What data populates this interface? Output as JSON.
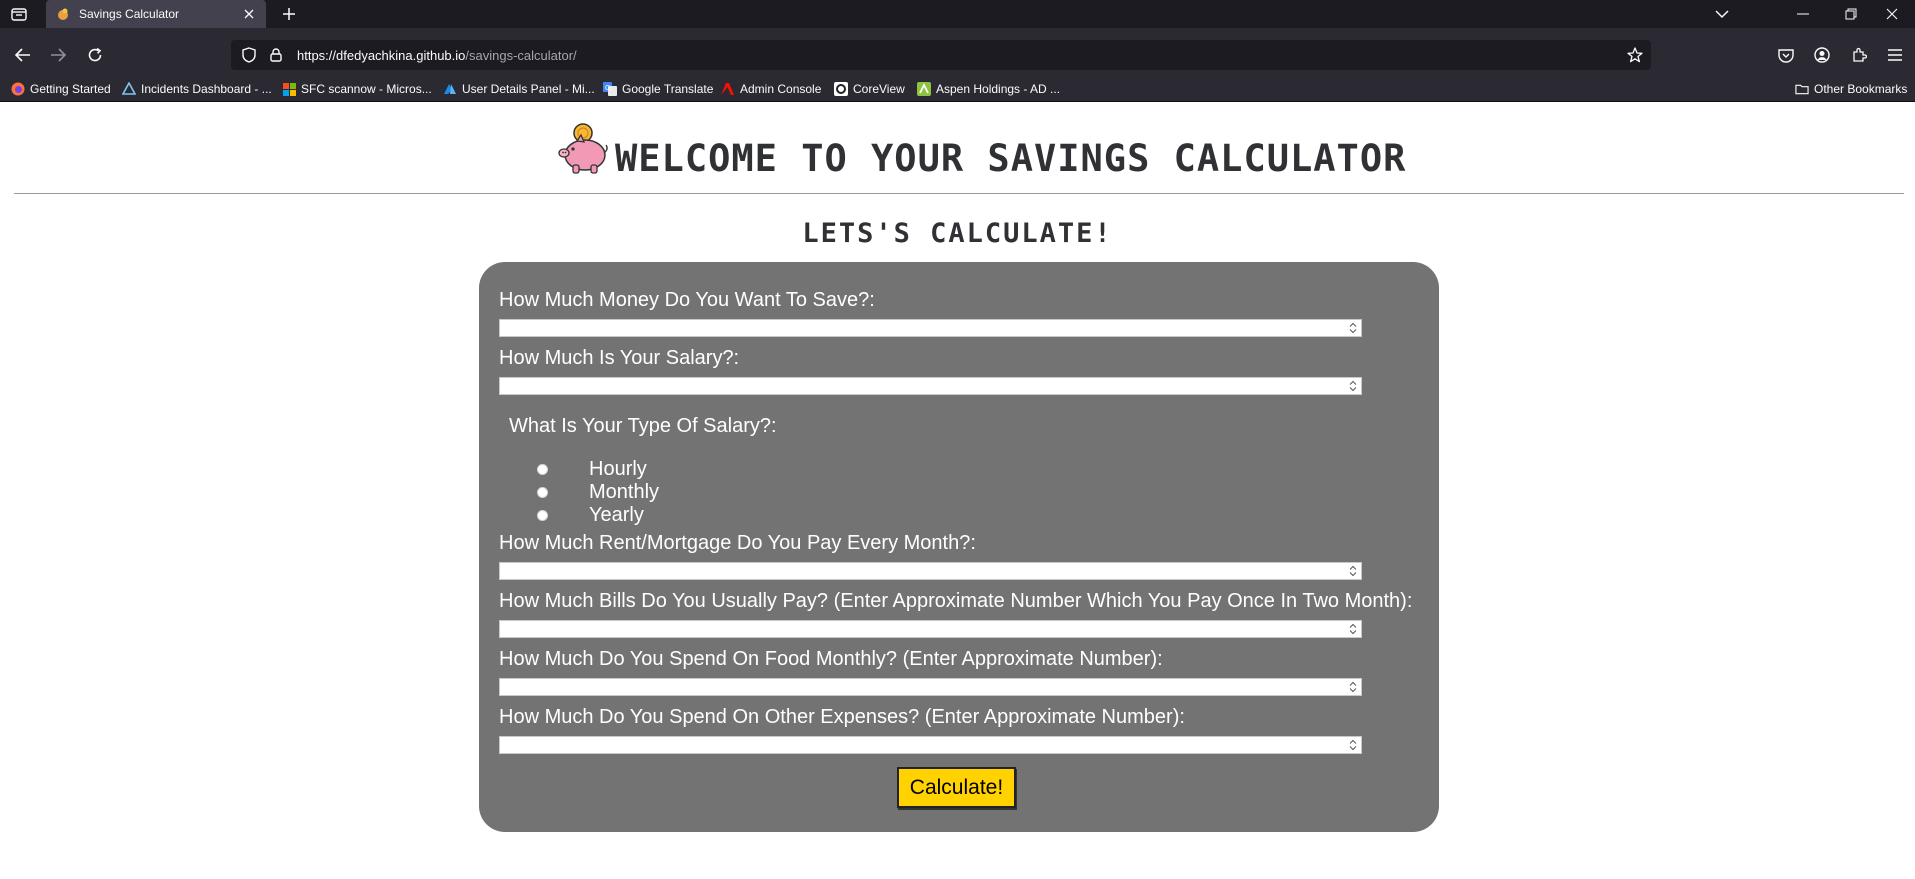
{
  "browser": {
    "tab": {
      "title": "Savings Calculator"
    },
    "url": {
      "host": "https://dfedyachkina.github.io",
      "path": "/savings-calculator/"
    },
    "bookmarks": [
      {
        "label": "Getting Started",
        "icon": "firefox-icon"
      },
      {
        "label": "Incidents Dashboard - ...",
        "icon": "azure-icon"
      },
      {
        "label": "SFC scannow - Micros...",
        "icon": "microsoft-icon"
      },
      {
        "label": "User Details Panel - Mi...",
        "icon": "azure-ad-icon"
      },
      {
        "label": "Google Translate",
        "icon": "translate-icon"
      },
      {
        "label": "Admin Console",
        "icon": "adobe-icon"
      },
      {
        "label": "CoreView",
        "icon": "coreview-icon"
      },
      {
        "label": "Aspen Holdings - AD ...",
        "icon": "aspen-icon"
      }
    ],
    "other_bookmarks": "Other Bookmarks"
  },
  "page": {
    "title": "WELCOME TO YOUR SAVINGS CALCULATOR",
    "subtitle": "LETS'S CALCULATE!",
    "form": {
      "q_save": "How Much Money Do You Want To Save?:",
      "q_salary": "How Much Is Your Salary?:",
      "q_salary_type": "What Is Your Type Of Salary?:",
      "salary_types": [
        "Hourly",
        "Monthly",
        "Yearly"
      ],
      "q_rent": "How Much Rent/Mortgage Do You Pay Every Month?:",
      "q_bills": "How Much Bills Do You Usually Pay? (Enter Approximate Number Which You Pay Once In Two Month):",
      "q_food": "How Much Do You Spend On Food Monthly? (Enter Approximate Number):",
      "q_other": "How Much Do You Spend On Other Expenses? (Enter Approximate Number):",
      "submit_label": "Calculate!"
    }
  },
  "colors": {
    "card": "#737373",
    "button": "#ffd200",
    "title": "#2f3134"
  }
}
